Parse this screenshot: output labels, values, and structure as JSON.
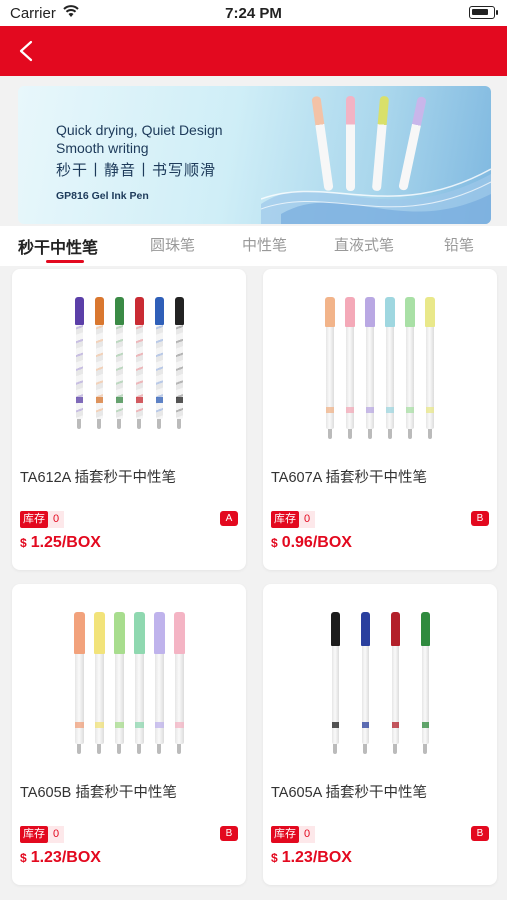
{
  "status": {
    "carrier": "Carrier",
    "time": "7:24 PM"
  },
  "nav": {
    "back_icon": "chevron-left-icon"
  },
  "banner": {
    "line1": "Quick drying, Quiet Design",
    "line2": "Smooth writing",
    "line3": "秒干丨静音丨书写顺滑",
    "line4": "GP816 Gel Ink Pen"
  },
  "tabs": [
    "秒干中性笔",
    "圆珠笔",
    "中性笔",
    "直液式笔",
    "铅笔"
  ],
  "products": [
    {
      "name": "TA612A 插套秒干中性笔",
      "stock_label": "库存",
      "stock": "0",
      "grade": "A",
      "currency": "$",
      "price": "1.25/BOX",
      "pen_colors": [
        "#5b3fa8",
        "#d9772f",
        "#3a8a45",
        "#c92b33",
        "#2f5fb8",
        "#222222"
      ]
    },
    {
      "name": "TA607A 插套秒干中性笔",
      "stock_label": "库存",
      "stock": "0",
      "grade": "B",
      "currency": "$",
      "price": "0.96/BOX",
      "pen_colors": [
        "#f2b48a",
        "#f4a9b8",
        "#b9a8e3",
        "#9fd7e0",
        "#a9e0a6",
        "#e9e88a"
      ]
    },
    {
      "name": "TA605B 插套秒干中性笔",
      "stock_label": "库存",
      "stock": "0",
      "grade": "B",
      "currency": "$",
      "price": "1.23/BOX",
      "pen_colors": [
        "#f2a27c",
        "#f2e37a",
        "#a8dd8e",
        "#8fd8b0",
        "#bfb3ec",
        "#f4b4c4"
      ]
    },
    {
      "name": "TA605A 插套秒干中性笔",
      "stock_label": "库存",
      "stock": "0",
      "grade": "B",
      "currency": "$",
      "price": "1.23/BOX",
      "pen_colors": [
        "#1c1c1c",
        "#2a3f9e",
        "#b3202a",
        "#2f8a3e"
      ]
    }
  ],
  "colors": {
    "accent": "#e3091f"
  }
}
